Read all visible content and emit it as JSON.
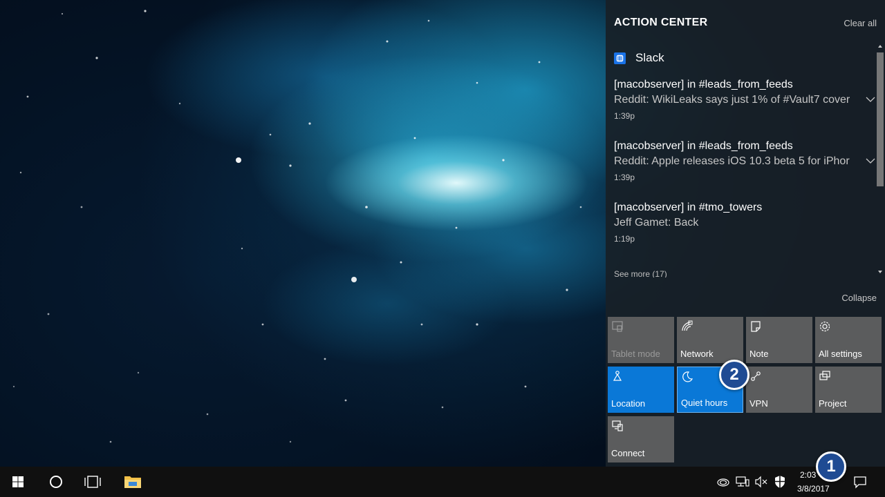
{
  "action_center": {
    "title": "ACTION CENTER",
    "clear_all": "Clear all",
    "app_name": "Slack",
    "notifications": [
      {
        "title": "[macobserver] in #leads_from_feeds",
        "body": "Reddit: WikiLeaks says just 1% of #Vault7 cover",
        "time": "1:39p"
      },
      {
        "title": "[macobserver] in #leads_from_feeds",
        "body": "Reddit: Apple releases iOS 10.3 beta 5 for iPhor",
        "time": "1:39p"
      },
      {
        "title": "[macobserver] in #tmo_towers",
        "body": "Jeff Gamet: Back",
        "time": "1:19p"
      }
    ],
    "see_more": "See more (17)",
    "collapse": "Collapse",
    "quick_actions": [
      {
        "label": "Tablet mode",
        "icon": "tablet-mode-icon",
        "state": "disabled"
      },
      {
        "label": "Network",
        "icon": "network-icon",
        "state": "off"
      },
      {
        "label": "Note",
        "icon": "note-icon",
        "state": "off"
      },
      {
        "label": "All settings",
        "icon": "gear-icon",
        "state": "off"
      },
      {
        "label": "Location",
        "icon": "location-icon",
        "state": "on"
      },
      {
        "label": "Quiet hours",
        "icon": "moon-icon",
        "state": "on"
      },
      {
        "label": "VPN",
        "icon": "vpn-icon",
        "state": "off"
      },
      {
        "label": "Project",
        "icon": "project-icon",
        "state": "off"
      },
      {
        "label": "Connect",
        "icon": "connect-icon",
        "state": "off"
      }
    ]
  },
  "badges": {
    "step_1": "1",
    "step_2": "2"
  },
  "taskbar": {
    "clock_time": "2:03",
    "clock_date": "3/8/2017"
  },
  "colors": {
    "accent": "#0a78d7",
    "tile_off": "#626262",
    "panel": "#182028",
    "badge": "#1f4b93",
    "taskbar": "#101010"
  }
}
